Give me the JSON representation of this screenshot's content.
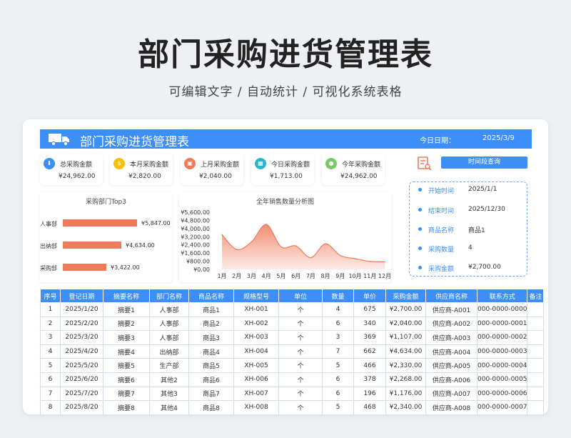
{
  "page": {
    "title": "部门采购进货管理表",
    "subtitle": "可编辑文字 / 自动统计 / 可视化系统表格"
  },
  "header": {
    "title": "部门采购进货管理表",
    "date_label": "今日日期：",
    "date_value": "2025/3/9",
    "icon": "truck-icon"
  },
  "stats": [
    {
      "label": "总采购金额",
      "value": "¥24,962.00",
      "icon": "download-icon",
      "color": "#3d8ef6"
    },
    {
      "label": "本月采购金额",
      "value": "¥2,820.00",
      "icon": "dollar-icon",
      "color": "#f4c20d"
    },
    {
      "label": "上月采购金额",
      "value": "¥2,040.00",
      "icon": "cart-icon",
      "color": "#f07a5a"
    },
    {
      "label": "今日采购金额",
      "value": "¥1,713.00",
      "icon": "calendar-icon",
      "color": "#2bb5c9"
    },
    {
      "label": "今年采购金额",
      "value": "¥24,962.00",
      "icon": "coins-icon",
      "color": "#7bc86c"
    }
  ],
  "dept_chart": {
    "title": "采购部门Top3",
    "items": [
      {
        "name": "人事部",
        "value": 5847,
        "label": "¥5,847.00"
      },
      {
        "name": "出纳部",
        "value": 4634,
        "label": "¥4,634.00"
      },
      {
        "name": "采购部",
        "value": 3422,
        "label": "¥3,422.00"
      }
    ]
  },
  "chart_data": {
    "type": "area",
    "title": "全年销售数量分析图",
    "categories": [
      "1月",
      "2月",
      "3月",
      "4月",
      "5月",
      "6月",
      "7月",
      "8月",
      "9月",
      "10月",
      "11月",
      "12月"
    ],
    "values": [
      3400,
      1950,
      2700,
      4400,
      2200,
      2300,
      1150,
      2500,
      1350,
      1050,
      780,
      740
    ],
    "yticks": [
      "¥5,600.00",
      "¥4,800.00",
      "¥4,000.00",
      "¥3,200.00",
      "¥2,400.00",
      "¥1,600.00",
      "¥800.00",
      "¥0.00"
    ],
    "ylim": [
      0,
      5600
    ],
    "color": "#f07a5a"
  },
  "query": {
    "button_label": "时间段查询",
    "rows": [
      {
        "key": "开始时间",
        "value": "2025/1/1"
      },
      {
        "key": "结束时间",
        "value": "2025/12/30"
      },
      {
        "key": "商品名称",
        "value": "商品1"
      },
      {
        "key": "采购数量",
        "value": "4"
      },
      {
        "key": "采购金额",
        "value": "¥2,700.00"
      }
    ]
  },
  "table": {
    "columns": [
      "序号",
      "登记日期",
      "摘要名称",
      "部门名称",
      "商品名称",
      "规格型号",
      "单位",
      "数量",
      "单价",
      "采购金额",
      "供应商名称",
      "联系方式",
      "备注"
    ],
    "rows": [
      [
        "1",
        "2025/1/20",
        "摘要1",
        "人事部",
        "商品1",
        "XH-001",
        "个",
        "4",
        "675",
        "¥2,700.00",
        "供应商-A001",
        "000-0000-0000",
        ""
      ],
      [
        "2",
        "2025/2/20",
        "摘要2",
        "人事部",
        "商品2",
        "XH-002",
        "个",
        "6",
        "340",
        "¥2,040.00",
        "供应商-A002",
        "000-0000-0001",
        ""
      ],
      [
        "3",
        "2025/3/20",
        "摘要3",
        "人事部",
        "商品3",
        "XH-003",
        "个",
        "3",
        "369",
        "¥1,107.00",
        "供应商-A003",
        "000-0000-0002",
        ""
      ],
      [
        "4",
        "2025/4/20",
        "摘要4",
        "出纳部",
        "商品4",
        "XH-004",
        "个",
        "7",
        "662",
        "¥4,634.00",
        "供应商-A004",
        "000-0000-0003",
        ""
      ],
      [
        "5",
        "2025/5/20",
        "摘要5",
        "生产部",
        "商品5",
        "XH-005",
        "个",
        "5",
        "466",
        "¥2,330.00",
        "供应商-A005",
        "000-0000-0004",
        ""
      ],
      [
        "6",
        "2025/6/20",
        "摘要6",
        "其他2",
        "商品6",
        "XH-006",
        "个",
        "6",
        "378",
        "¥2,268.00",
        "供应商-A006",
        "000-0000-0005",
        ""
      ],
      [
        "7",
        "2025/7/20",
        "摘要7",
        "其他3",
        "商品7",
        "XH-007",
        "个",
        "6",
        "196",
        "¥1,176.00",
        "供应商-A007",
        "000-0000-0006",
        ""
      ],
      [
        "8",
        "2025/8/20",
        "摘要8",
        "其他4",
        "商品8",
        "XH-008",
        "个",
        "5",
        "468",
        "¥2,340.00",
        "供应商-A008",
        "000-0000-0007",
        ""
      ]
    ]
  }
}
